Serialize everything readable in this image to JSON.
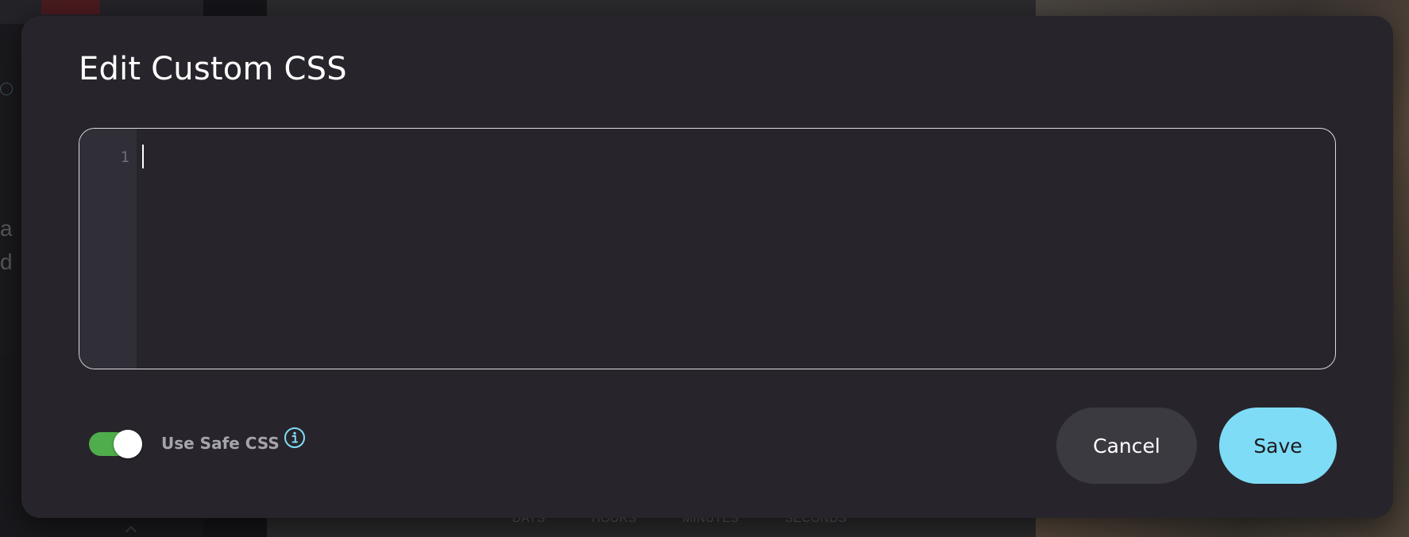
{
  "modal": {
    "title": "Edit Custom CSS",
    "editor": {
      "line_numbers": [
        "1"
      ],
      "content": ""
    },
    "safe_css_toggle": {
      "label": "Use Safe CSS",
      "enabled": true
    },
    "buttons": {
      "cancel_label": "Cancel",
      "save_label": "Save"
    }
  },
  "background": {
    "left_fragments": [
      "a",
      "d"
    ],
    "countdown_units": [
      "DAYS",
      "HOURS",
      "MINUTES",
      "SECONDS"
    ]
  },
  "colors": {
    "modal_bg": "#27252b",
    "gutter_bg": "#302e37",
    "toggle_on": "#4fad4c",
    "save_button": "#7fdcf7",
    "cancel_button": "#3b3a40",
    "info_icon": "#7fdcf7"
  },
  "icons": {
    "info": "info-icon"
  }
}
